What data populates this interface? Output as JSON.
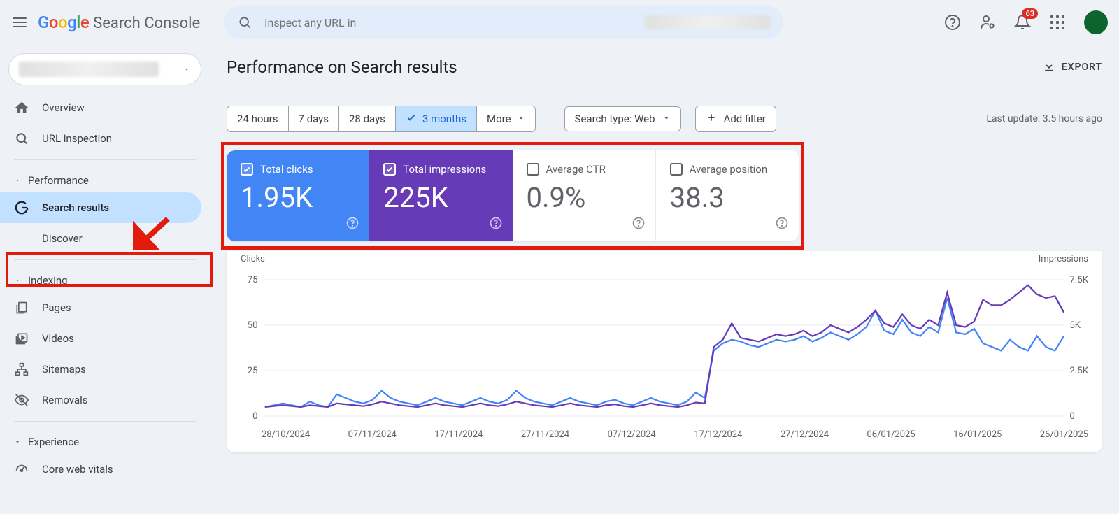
{
  "header": {
    "product_name_google": "Google",
    "product_name_suffix": "Search Console",
    "search_placeholder": "Inspect any URL in",
    "notification_count": "63"
  },
  "sidebar": {
    "items": {
      "overview": "Overview",
      "url_inspection": "URL inspection",
      "performance": "Performance",
      "search_results": "Search results",
      "discover": "Discover",
      "indexing": "Indexing",
      "pages": "Pages",
      "videos": "Videos",
      "sitemaps": "Sitemaps",
      "removals": "Removals",
      "experience": "Experience",
      "core_web_vitals": "Core web vitals"
    }
  },
  "page": {
    "title": "Performance on Search results",
    "export": "EXPORT"
  },
  "toolbar": {
    "range": {
      "h24": "24 hours",
      "d7": "7 days",
      "d28": "28 days",
      "m3": "3 months",
      "more": "More"
    },
    "search_type": "Search type: Web",
    "add_filter": "Add filter",
    "last_update": "Last update: 3.5 hours ago"
  },
  "metrics": {
    "clicks": {
      "label": "Total clicks",
      "value": "1.95K",
      "active": true,
      "color": "blue"
    },
    "impressions": {
      "label": "Total impressions",
      "value": "225K",
      "active": true,
      "color": "purple"
    },
    "ctr": {
      "label": "Average CTR",
      "value": "0.9%",
      "active": false
    },
    "position": {
      "label": "Average position",
      "value": "38.3",
      "active": false
    }
  },
  "chart": {
    "left_header": "Clicks",
    "right_header": "Impressions",
    "left_ticks": {
      "t75": "75",
      "t50": "50",
      "t25": "25",
      "t0": "0"
    },
    "right_ticks": {
      "t75k": "7.5K",
      "t5k": "5K",
      "t25k": "2.5K",
      "t0": "0"
    },
    "dates": {
      "d0": "28/10/2024",
      "d1": "07/11/2024",
      "d2": "17/11/2024",
      "d3": "27/11/2024",
      "d4": "07/12/2024",
      "d5": "17/12/2024",
      "d6": "27/12/2024",
      "d7": "06/01/2025",
      "d8": "16/01/2025",
      "d9": "26/01/2025"
    }
  },
  "chart_data": {
    "type": "line",
    "xlabel": "",
    "ylabel_left": "Clicks",
    "ylabel_right": "Impressions",
    "ylim_left": [
      0,
      75
    ],
    "ylim_right": [
      0,
      7500
    ],
    "x_dates": [
      "28/10/2024",
      "07/11/2024",
      "17/11/2024",
      "27/11/2024",
      "07/12/2024",
      "17/12/2024",
      "27/12/2024",
      "06/01/2025",
      "16/01/2025",
      "26/01/2025"
    ],
    "series": [
      {
        "name": "Clicks",
        "axis": "left",
        "color": "#4285f4",
        "values": [
          5,
          6,
          7,
          6,
          5,
          8,
          6,
          5,
          12,
          10,
          8,
          7,
          9,
          14,
          10,
          8,
          7,
          6,
          8,
          10,
          8,
          7,
          6,
          8,
          10,
          8,
          7,
          9,
          14,
          10,
          8,
          7,
          6,
          8,
          10,
          8,
          7,
          6,
          8,
          9,
          7,
          6,
          8,
          10,
          8,
          7,
          6,
          8,
          13,
          10,
          36,
          40,
          42,
          41,
          39,
          38,
          40,
          42,
          41,
          42,
          44,
          41,
          43,
          46,
          44,
          42,
          45,
          49,
          58,
          47,
          45,
          53,
          46,
          44,
          49,
          46,
          65,
          46,
          45,
          48,
          40,
          38,
          36,
          42,
          38,
          36,
          44,
          38,
          36,
          44
        ]
      },
      {
        "name": "Impressions",
        "axis": "right",
        "color": "#673ab7",
        "values": [
          500,
          550,
          600,
          550,
          500,
          600,
          550,
          500,
          700,
          650,
          600,
          550,
          650,
          800,
          700,
          600,
          550,
          500,
          600,
          700,
          600,
          550,
          500,
          600,
          700,
          600,
          550,
          650,
          800,
          700,
          600,
          550,
          500,
          600,
          700,
          600,
          550,
          500,
          600,
          650,
          550,
          500,
          600,
          700,
          600,
          550,
          500,
          600,
          750,
          700,
          3800,
          4200,
          5100,
          4300,
          4200,
          4100,
          4300,
          4500,
          4400,
          4500,
          4700,
          4400,
          4600,
          5000,
          4800,
          4600,
          4900,
          5300,
          5800,
          5100,
          4900,
          5600,
          5000,
          4800,
          5300,
          5000,
          6800,
          5000,
          4900,
          5200,
          6400,
          6100,
          6100,
          6400,
          6800,
          7200,
          6700,
          6500,
          6600,
          5700
        ]
      }
    ]
  }
}
